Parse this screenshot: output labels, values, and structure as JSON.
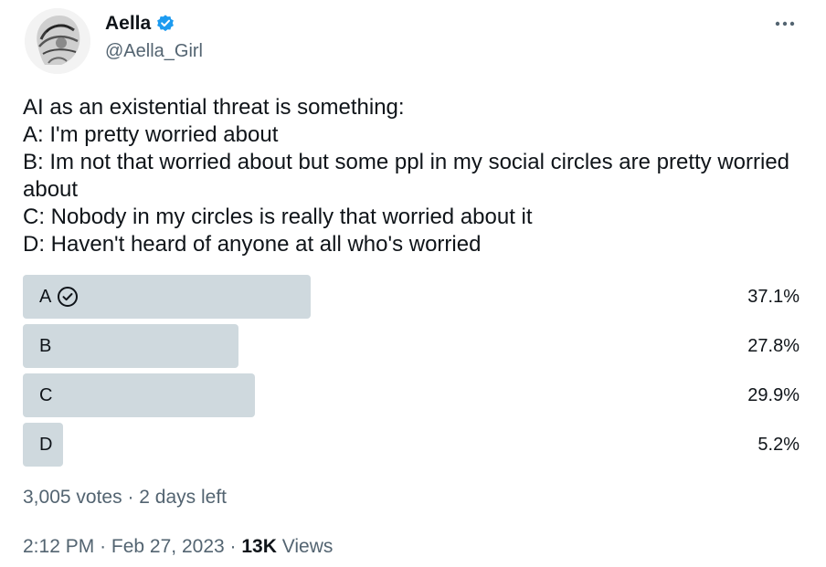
{
  "author": {
    "name": "Aella",
    "handle": "@Aella_Girl",
    "verified_color": "#1d9bf0"
  },
  "icons": {
    "verified": "verified-badge-icon",
    "more": "more-options-icon",
    "check": "check-circle-icon"
  },
  "tweet": {
    "lines": [
      "AI as an existential threat is something:",
      "A: I'm pretty worried about",
      "B: Im not that worried about but some ppl in my social circles are pretty worried about",
      "C: Nobody in my circles is really that worried about it",
      "D: Haven't heard of anyone at all who's worried"
    ]
  },
  "poll": {
    "options": [
      {
        "label": "A",
        "percent_text": "37.1%",
        "percent": 37.1,
        "winner": true
      },
      {
        "label": "B",
        "percent_text": "27.8%",
        "percent": 27.8,
        "winner": false
      },
      {
        "label": "C",
        "percent_text": "29.9%",
        "percent": 29.9,
        "winner": false
      },
      {
        "label": "D",
        "percent_text": "5.2%",
        "percent": 5.2,
        "winner": false
      }
    ],
    "votes": "3,005 votes",
    "separator": "·",
    "time_left": "2 days left"
  },
  "footer": {
    "time": "2:12 PM",
    "date": "Feb 27, 2023",
    "views_count": "13K",
    "views_label": "Views",
    "separator": "·"
  }
}
